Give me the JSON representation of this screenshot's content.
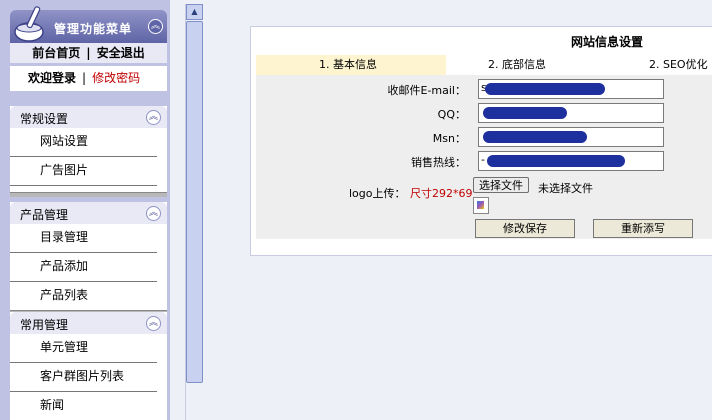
{
  "sidebar": {
    "title": "管理功能菜单",
    "links": {
      "front": "前台首页",
      "logout": "安全退出",
      "separator": "|"
    },
    "user": {
      "welcome": "欢迎登录",
      "change_password": "修改密码",
      "separator": "|"
    },
    "groups": [
      {
        "title": "常规设置",
        "items": [
          "网站设置",
          "广告图片"
        ]
      },
      {
        "title": "产品管理",
        "items": [
          "目录管理",
          "产品添加",
          "产品列表"
        ]
      },
      {
        "title": "常用管理",
        "items": [
          "单元管理",
          "客户群图片列表",
          "新闻"
        ]
      }
    ]
  },
  "panel": {
    "title": "网站信息设置",
    "tabs": [
      "1. 基本信息",
      "2. 底部信息",
      "2. SEO优化"
    ],
    "fields": [
      {
        "label": "收邮件E-mail：",
        "value": "s"
      },
      {
        "label": "QQ：",
        "value": ""
      },
      {
        "label": "Msn：",
        "value": ""
      },
      {
        "label": "销售热线：",
        "value": "-"
      }
    ],
    "logo": {
      "label": "logo上传：",
      "hint": "尺寸292*69",
      "choose_button": "选择文件",
      "no_file": "未选择文件"
    },
    "save_button": "修改保存",
    "reset_button": "重新添写"
  },
  "colors": {
    "sidebar_bg": "#bfc2e3",
    "redaction": "#1e2f9e",
    "active_tab": "#fef5d0",
    "hint_red": "#c00000"
  }
}
